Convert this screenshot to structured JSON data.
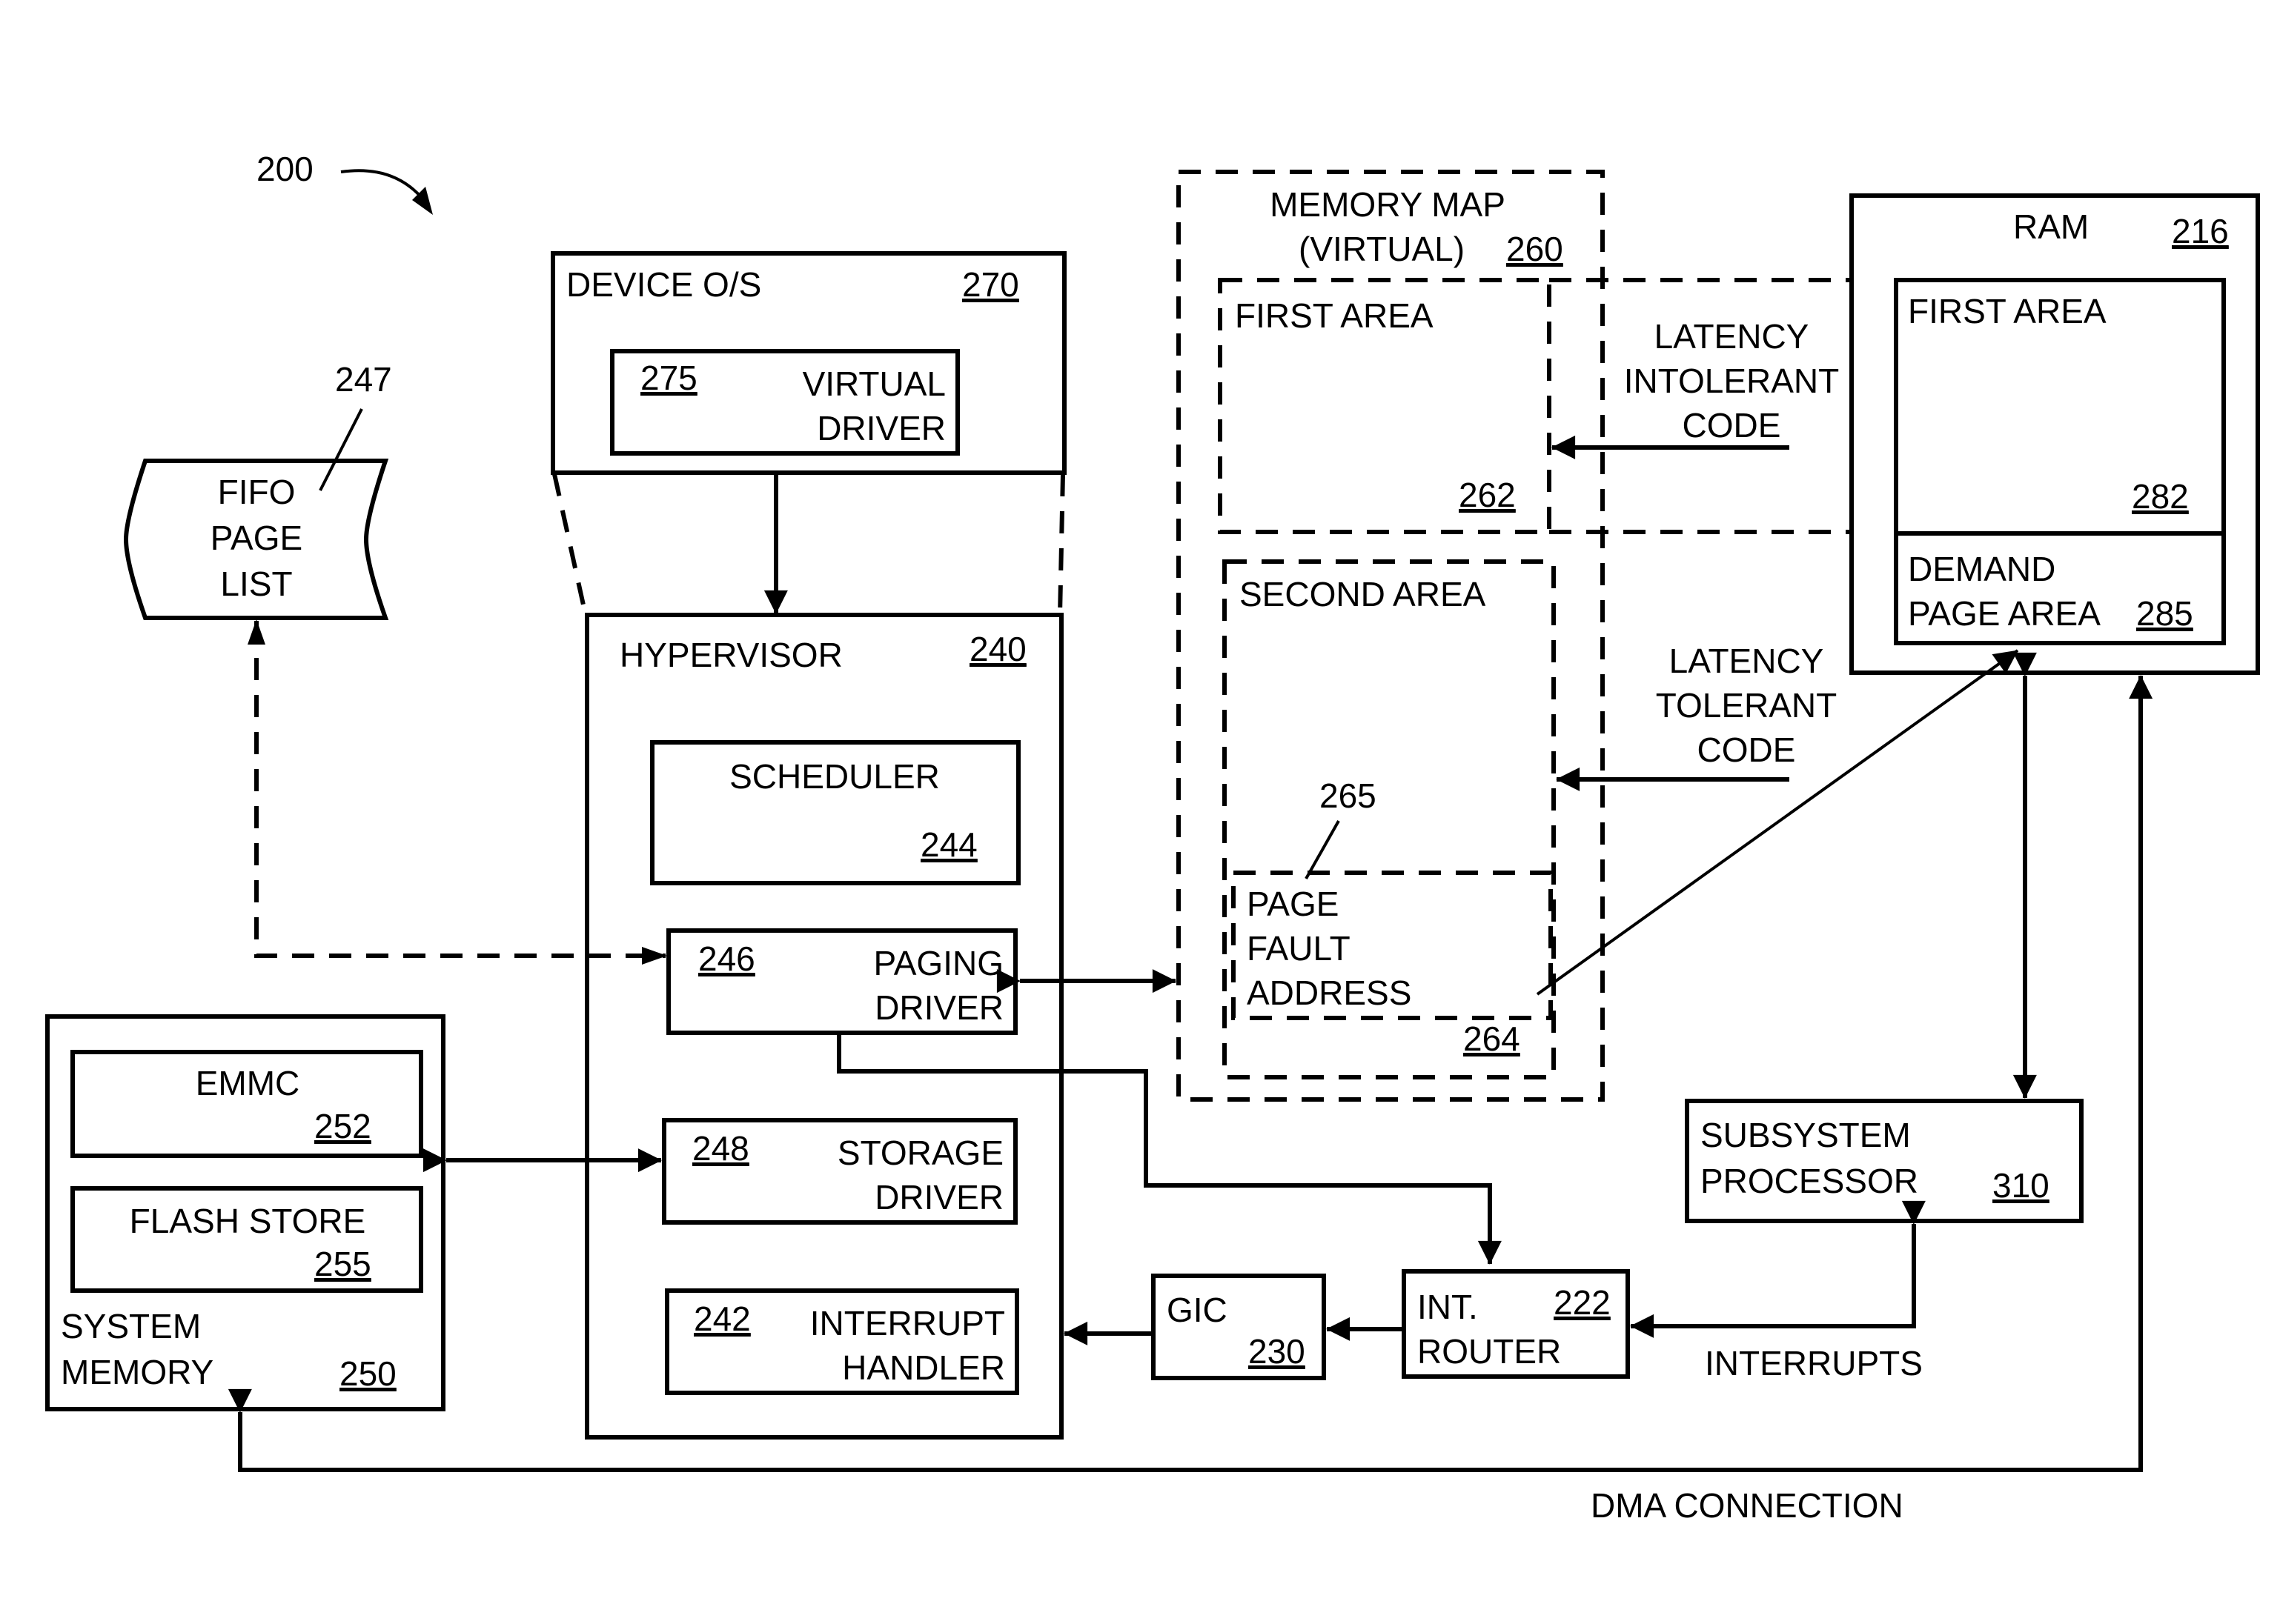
{
  "figure": {
    "ref": "200",
    "colors": {
      "ink": "#000000",
      "background": "#ffffff"
    }
  },
  "fifo": {
    "lines": [
      "FIFO",
      "PAGE",
      "LIST"
    ],
    "ref": "247"
  },
  "device_os": {
    "title": "DEVICE O/S",
    "ref": "270",
    "virtual_driver": {
      "ref": "275",
      "lines": [
        "VIRTUAL",
        "DRIVER"
      ]
    }
  },
  "hypervisor": {
    "title": "HYPERVISOR",
    "ref": "240",
    "scheduler": {
      "label": "SCHEDULER",
      "ref": "244"
    },
    "paging_driver": {
      "ref": "246",
      "lines": [
        "PAGING",
        "DRIVER"
      ]
    },
    "storage_driver": {
      "ref": "248",
      "lines": [
        "STORAGE",
        "DRIVER"
      ]
    },
    "interrupt_handler": {
      "ref": "242",
      "lines": [
        "INTERRUPT",
        "HANDLER"
      ]
    }
  },
  "memory_map": {
    "lines": [
      "MEMORY MAP",
      "(VIRTUAL)"
    ],
    "ref": "260",
    "first_area": {
      "label": "FIRST AREA",
      "ref": "262"
    },
    "second_area": {
      "label": "SECOND AREA",
      "ref": "264",
      "page_fault": {
        "lines": [
          "PAGE",
          "FAULT",
          "ADDRESS"
        ],
        "ref": "265"
      }
    }
  },
  "ram": {
    "title": "RAM",
    "ref": "216",
    "first_area": {
      "label": "FIRST AREA",
      "ref": "282"
    },
    "demand_page": {
      "lines": [
        "DEMAND",
        "PAGE AREA"
      ],
      "ref": "285"
    }
  },
  "labels": {
    "latency_intolerant": [
      "LATENCY",
      "INTOLERANT",
      "CODE"
    ],
    "latency_tolerant": [
      "LATENCY",
      "TOLERANT",
      "CODE"
    ],
    "interrupts": "INTERRUPTS",
    "dma": "DMA CONNECTION"
  },
  "system_memory": {
    "lines": [
      "SYSTEM",
      "MEMORY"
    ],
    "ref": "250",
    "emmc": {
      "label": "EMMC",
      "ref": "252"
    },
    "flash": {
      "label": "FLASH STORE",
      "ref": "255"
    }
  },
  "gic": {
    "label": "GIC",
    "ref": "230"
  },
  "router": {
    "lines": [
      "INT.",
      "ROUTER"
    ],
    "ref": "222"
  },
  "subsystem": {
    "lines": [
      "SUBSYSTEM",
      "PROCESSOR"
    ],
    "ref": "310"
  }
}
